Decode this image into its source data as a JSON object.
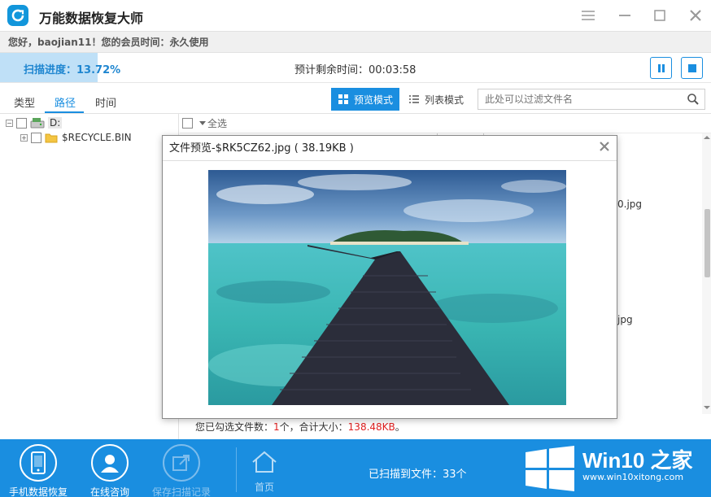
{
  "app": {
    "title": "万能数据恢复大师"
  },
  "welcome": {
    "text": "您好，baojian11！您的会员时间：永久使用"
  },
  "scan": {
    "progress_label": "扫描进度：13.72%",
    "progress_fraction": 0.1372,
    "remaining_label": "预计剩余时间：00:03:58"
  },
  "tabs": [
    {
      "label": "类型"
    },
    {
      "label": "路径"
    },
    {
      "label": "时间"
    }
  ],
  "view_modes": {
    "preview": "预览模式",
    "list": "列表模式"
  },
  "filter": {
    "placeholder": "此处可以过滤文件名"
  },
  "tree": {
    "root": "D:",
    "child": "$RECYCLE.BIN"
  },
  "content": {
    "select_all": "全选",
    "thumbs": [
      {
        "label": "0.jpg"
      },
      {
        "label": "jpg"
      }
    ]
  },
  "summary": {
    "prefix": "您已勾选文件数：",
    "count": "1",
    "mid": "个，合计大小：",
    "size": "138.48KB",
    "suffix": "。"
  },
  "dialog": {
    "title": "文件预览-$RK5CZ62.jpg ( 38.19KB )"
  },
  "bottom": {
    "phone_recovery": "手机数据恢复",
    "online_consult": "在线咨询",
    "save_record": "保存扫描记录",
    "home": "首页",
    "scanned": "已扫描到文件：33个"
  },
  "watermark": {
    "title": "Win10 之家",
    "url": "www.win10xitong.com"
  },
  "colors": {
    "accent": "#1a8ee0",
    "progress": "#bfe0f7",
    "red": "#e02020"
  }
}
